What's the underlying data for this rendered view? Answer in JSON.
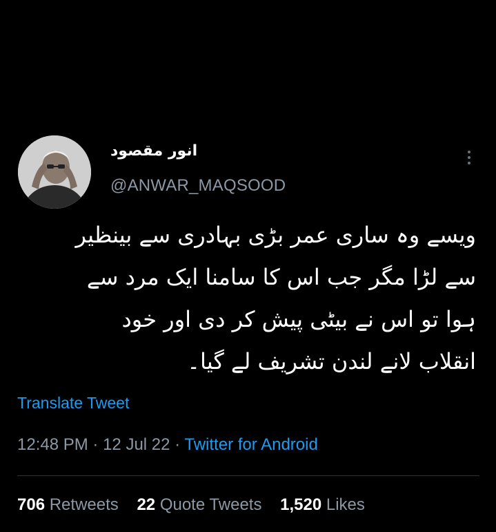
{
  "author": {
    "display_name": "انور مقصود",
    "handle": "@ANWAR_MAQSOOD"
  },
  "tweet": {
    "lines": [
      "ویسے وہ ساری عمر بڑی بہادری سے بینظیر",
      "سے لڑا مگر جب اس کا سامنا ایک مرد سے",
      "ہوا تو اس نے بیٹی پیش کر دی اور خود",
      "انقلاب لانے لندن تشریف لے گیا۔"
    ],
    "translate_label": "Translate Tweet",
    "time": "12:48 PM",
    "date": "12 Jul 22",
    "separator": "·",
    "source": "Twitter for Android"
  },
  "stats": {
    "retweets_count": "706",
    "retweets_label": "Retweets",
    "quotes_count": "22",
    "quotes_label": "Quote Tweets",
    "likes_count": "1,520",
    "likes_label": "Likes"
  },
  "icons": {
    "more": "more-vertical-icon"
  },
  "colors": {
    "background": "#000000",
    "text": "#ffffff",
    "secondary": "#8b98a5",
    "link": "#1d9bf0"
  }
}
